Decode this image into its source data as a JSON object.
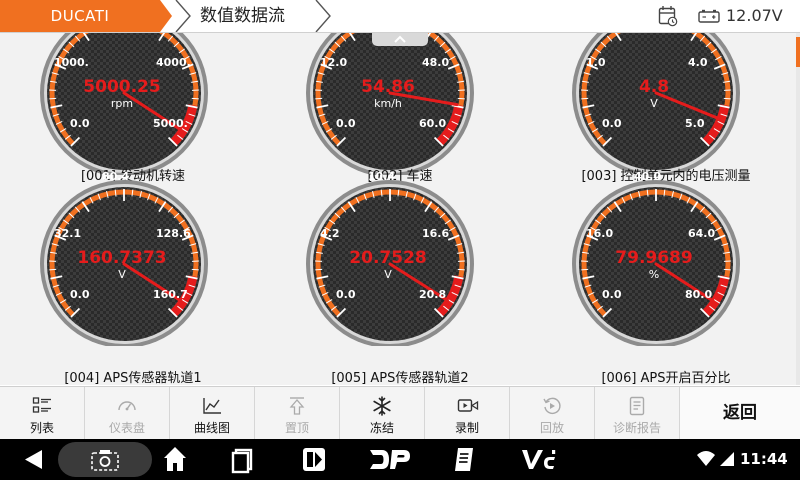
{
  "header": {
    "brand": "DUCATI",
    "title": "数值数据流",
    "voltage": "12.07V",
    "icons": [
      "calendar-clock-icon",
      "battery-icon"
    ]
  },
  "gauges": [
    {
      "label": "[001] 发动机转速",
      "value": "5000.25",
      "unit": "rpm",
      "value_num": 5000.25,
      "min": 0,
      "max": 5000,
      "ticks": [
        "0.0",
        "1000.",
        "4000.",
        "5000.",
        "2000."
      ]
    },
    {
      "label": "[002] 车速",
      "value": "54.86",
      "unit": "km/h",
      "value_num": 54.86,
      "min": 0,
      "max": 60,
      "ticks": [
        "0.0",
        "12.0",
        "48.0",
        "60.0",
        ""
      ]
    },
    {
      "label": "[003] 控制单元内的电压测量",
      "value": "4.8",
      "unit": "V",
      "value_num": 4.8,
      "min": 0,
      "max": 5,
      "ticks": [
        "0.0",
        "1.0",
        "4.0",
        "5.0",
        "2.0"
      ]
    },
    {
      "label": "[004] APS传感器轨道1",
      "value": "160.7373",
      "unit": "V",
      "value_num": 160.7373,
      "min": 0,
      "max": 160.7,
      "ticks": [
        "0.0",
        "32.1",
        "128.6",
        "160.7",
        "80.4"
      ]
    },
    {
      "label": "[005] APS传感器轨道2",
      "value": "20.7528",
      "unit": "V",
      "value_num": 20.7528,
      "min": 0,
      "max": 20.8,
      "ticks": [
        "0.0",
        "4.2",
        "16.6",
        "20.8",
        "10.4"
      ]
    },
    {
      "label": "[006] APS开启百分比",
      "value": "79.9689",
      "unit": "%",
      "value_num": 79.9689,
      "min": 0,
      "max": 80,
      "ticks": [
        "0.0",
        "16.0",
        "64.0",
        "80.0",
        "40.0"
      ]
    }
  ],
  "toolbar": {
    "buttons": [
      {
        "label": "列表",
        "icon": "list-icon",
        "enabled": true
      },
      {
        "label": "仪表盘",
        "icon": "dashboard-icon",
        "enabled": false
      },
      {
        "label": "曲线图",
        "icon": "line-chart-icon",
        "enabled": true
      },
      {
        "label": "置顶",
        "icon": "pin-top-icon",
        "enabled": false
      },
      {
        "label": "冻结",
        "icon": "snowflake-icon",
        "enabled": true
      },
      {
        "label": "录制",
        "icon": "record-icon",
        "enabled": true
      },
      {
        "label": "回放",
        "icon": "replay-icon",
        "enabled": false
      },
      {
        "label": "诊断报告",
        "icon": "report-icon",
        "enabled": false
      }
    ],
    "back": "返回"
  },
  "navbar": {
    "time": "11:44",
    "items": [
      "back-icon",
      "screenshot-icon",
      "home-icon",
      "recents-icon",
      "app-icon",
      "dp-logo-icon",
      "manual-icon",
      "vci-icon"
    ]
  },
  "colors": {
    "accent": "#f07020",
    "value_red": "#e51c1c",
    "dial_bg": "#333333"
  }
}
